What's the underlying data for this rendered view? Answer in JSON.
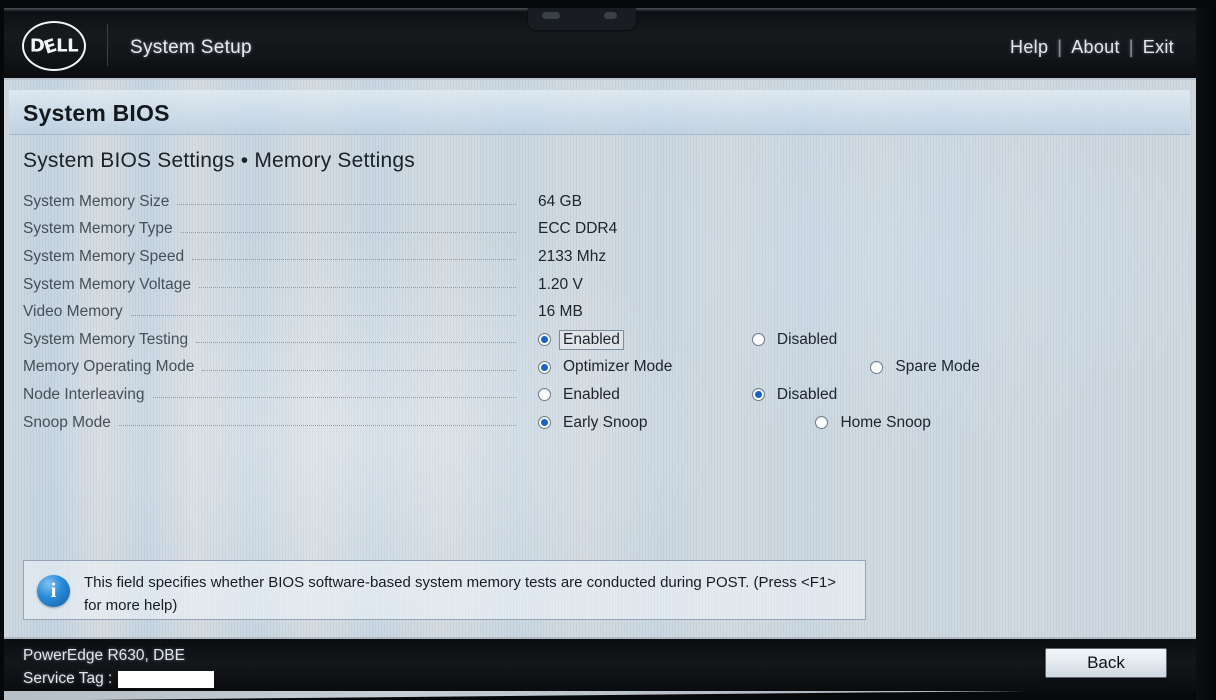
{
  "header": {
    "logo_alt": "DELL",
    "app_title": "System Setup",
    "nav": [
      {
        "label": "Help"
      },
      {
        "label": "About"
      },
      {
        "label": "Exit"
      }
    ],
    "separator": "|"
  },
  "page": {
    "title": "System BIOS",
    "breadcrumb": "System BIOS Settings • Memory Settings"
  },
  "settings": {
    "info_rows": [
      {
        "label": "System Memory Size",
        "value": "64 GB"
      },
      {
        "label": "System Memory Type",
        "value": "ECC DDR4"
      },
      {
        "label": "System Memory Speed",
        "value": "2133 Mhz"
      },
      {
        "label": "System Memory Voltage",
        "value": "1.20 V"
      },
      {
        "label": "Video Memory",
        "value": "16 MB"
      }
    ],
    "choice_rows": [
      {
        "label": "System Memory Testing",
        "options": [
          {
            "label": "Enabled",
            "selected": true,
            "focused": true,
            "offset": 0
          },
          {
            "label": "Disabled",
            "selected": false,
            "focused": false,
            "offset": 128
          }
        ]
      },
      {
        "label": "Memory Operating Mode",
        "options": [
          {
            "label": "Optimizer Mode",
            "selected": true,
            "focused": false,
            "offset": 0
          },
          {
            "label": "Spare Mode",
            "selected": false,
            "focused": false,
            "offset": 194
          }
        ]
      },
      {
        "label": "Node Interleaving",
        "options": [
          {
            "label": "Enabled",
            "selected": false,
            "focused": false,
            "offset": 0
          },
          {
            "label": "Disabled",
            "selected": true,
            "focused": false,
            "offset": 128
          }
        ]
      },
      {
        "label": "Snoop Mode",
        "options": [
          {
            "label": "Early Snoop",
            "selected": true,
            "focused": false,
            "offset": 0
          },
          {
            "label": "Home Snoop",
            "selected": false,
            "focused": false,
            "offset": 164
          }
        ]
      }
    ]
  },
  "help": {
    "icon": "info-icon",
    "text": "This field specifies whether BIOS software-based system memory tests are conducted during POST. (Press <F1> for more help)"
  },
  "footer": {
    "system_name": "PowerEdge R630, DBE",
    "service_tag_label": "Service Tag :",
    "service_tag_value": "",
    "back_label": "Back"
  },
  "colors": {
    "accent_blue": "#1763c8",
    "header_black": "#14161a",
    "screen_bg": "#cfd8e0",
    "label_gray": "#454f59",
    "value_dark": "#1d242b"
  }
}
